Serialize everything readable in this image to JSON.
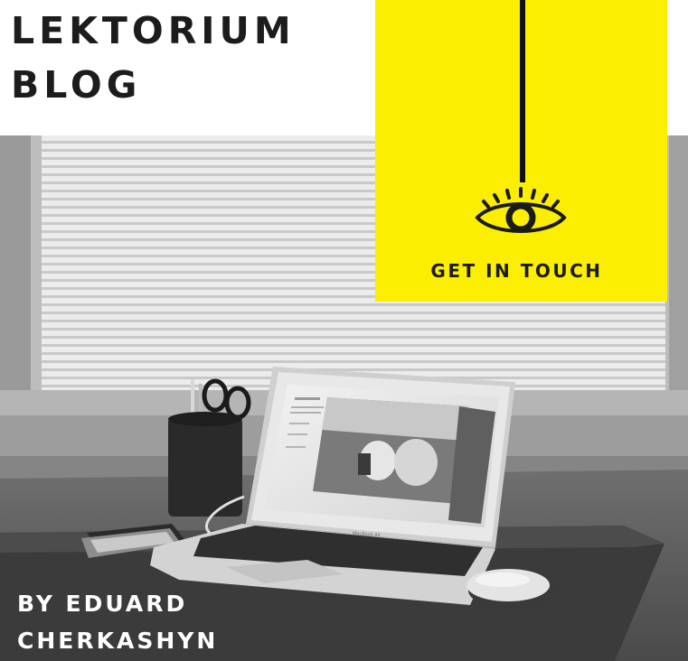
{
  "header": {
    "title_line_1": "LEKTORIUM",
    "title_line_2": "BLOG"
  },
  "cta": {
    "label": "GET IN TOUCH",
    "icon": "eye-icon"
  },
  "author": {
    "line_1": "BY EDUARD",
    "line_2": "CHERKASHYN"
  },
  "laptop": {
    "brand_label": "MacBook Air"
  },
  "colors": {
    "accent_yellow": "#fcee00",
    "text_dark": "#1c1c1c",
    "text_light": "#ffffff"
  }
}
